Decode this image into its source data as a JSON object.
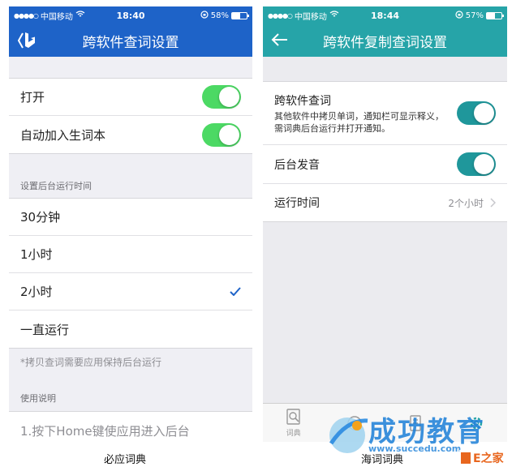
{
  "left": {
    "status": {
      "carrier": "中国移动",
      "time": "18:40",
      "battery": "58%",
      "battery_level": 0.58
    },
    "title": "跨软件查词设置",
    "toggles": [
      {
        "label": "打开",
        "on": true
      },
      {
        "label": "自动加入生词本",
        "on": true
      }
    ],
    "run_time_header": "设置后台运行时间",
    "options": [
      {
        "label": "30分钟",
        "selected": false
      },
      {
        "label": "1小时",
        "selected": false
      },
      {
        "label": "2小时",
        "selected": true
      },
      {
        "label": "一直运行",
        "selected": false
      }
    ],
    "note": "*拷贝查词需要应用保持后台运行",
    "usage_header": "使用说明",
    "usage_step": "1.按下Home键使应用进入后台",
    "caption": "必应词典",
    "accent": "#1e63c8",
    "switch_color": "#4cd964"
  },
  "right": {
    "status": {
      "carrier": "中国移动",
      "time": "18:44",
      "battery": "57%",
      "battery_level": 0.57
    },
    "title": "跨软件复制查词设置",
    "items": [
      {
        "label": "跨软件查词",
        "desc": "其他软件中拷贝单词，通知栏可显示释义，需词典后台运行并打开通知。",
        "on": true
      },
      {
        "label": "后台发音",
        "on": true
      }
    ],
    "runtime": {
      "label": "运行时间",
      "value": "2个小时"
    },
    "tabs": [
      {
        "label": "词典",
        "icon": "dictionary-icon"
      }
    ],
    "caption": "海词词典",
    "accent": "#26a4a8",
    "switch_color": "#1f979b"
  },
  "watermark": {
    "brand": "成功教育",
    "url": "www.succedu.com",
    "corner": "E之家"
  }
}
